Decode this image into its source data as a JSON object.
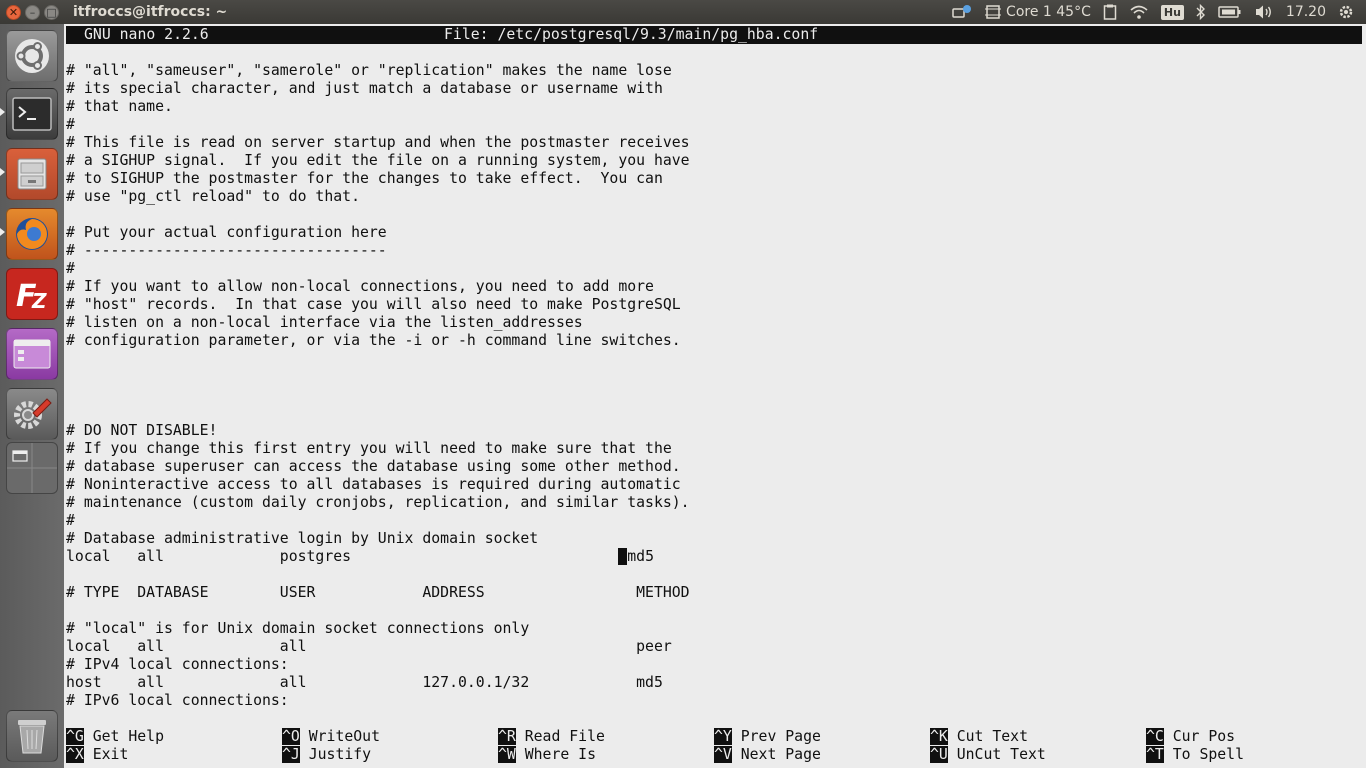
{
  "window": {
    "title": "itfroccs@itfroccs: ~"
  },
  "panel": {
    "cpu_label": "Core 1 45°C",
    "keyboard_layout": "Hu",
    "clock": "17.20"
  },
  "launcher": {
    "items": [
      "Ubuntu Dash",
      "Terminal",
      "Files",
      "Firefox",
      "FileZilla",
      "Unity Tweak",
      "System Settings",
      "Workspace Switcher",
      "Trash"
    ]
  },
  "nano": {
    "version": "GNU nano 2.2.6",
    "file": "File: /etc/postgresql/9.3/main/pg_hba.conf",
    "lines": [
      "# \"all\", \"sameuser\", \"samerole\" or \"replication\" makes the name lose",
      "# its special character, and just match a database or username with",
      "# that name.",
      "#",
      "# This file is read on server startup and when the postmaster receives",
      "# a SIGHUP signal.  If you edit the file on a running system, you have",
      "# to SIGHUP the postmaster for the changes to take effect.  You can",
      "# use \"pg_ctl reload\" to do that.",
      "",
      "# Put your actual configuration here",
      "# ----------------------------------",
      "#",
      "# If you want to allow non-local connections, you need to add more",
      "# \"host\" records.  In that case you will also need to make PostgreSQL",
      "# listen on a non-local interface via the listen_addresses",
      "# configuration parameter, or via the -i or -h command line switches.",
      "",
      "",
      "",
      "",
      "# DO NOT DISABLE!",
      "# If you change this first entry you will need to make sure that the",
      "# database superuser can access the database using some other method.",
      "# Noninteractive access to all databases is required during automatic",
      "# maintenance (custom daily cronjobs, replication, and similar tasks).",
      "#",
      "# Database administrative login by Unix domain socket",
      "",
      "",
      "# TYPE  DATABASE        USER            ADDRESS                 METHOD",
      "",
      "# \"local\" is for Unix domain socket connections only",
      "local   all             all                                     peer",
      "# IPv4 local connections:",
      "host    all             all             127.0.0.1/32            md5",
      "# IPv6 local connections:"
    ],
    "cursor_line": {
      "before": "local   all             postgres                              ",
      "cursor": " ",
      "after": "md5"
    },
    "shortcuts": [
      {
        "key": "^G",
        "label": " Get Help"
      },
      {
        "key": "^X",
        "label": " Exit"
      },
      {
        "key": "^O",
        "label": " WriteOut"
      },
      {
        "key": "^J",
        "label": " Justify"
      },
      {
        "key": "^R",
        "label": " Read File"
      },
      {
        "key": "^W",
        "label": " Where Is"
      },
      {
        "key": "^Y",
        "label": " Prev Page"
      },
      {
        "key": "^V",
        "label": " Next Page"
      },
      {
        "key": "^K",
        "label": " Cut Text"
      },
      {
        "key": "^U",
        "label": " UnCut Text"
      },
      {
        "key": "^C",
        "label": " Cur Pos"
      },
      {
        "key": "^T",
        "label": " To Spell"
      }
    ]
  }
}
